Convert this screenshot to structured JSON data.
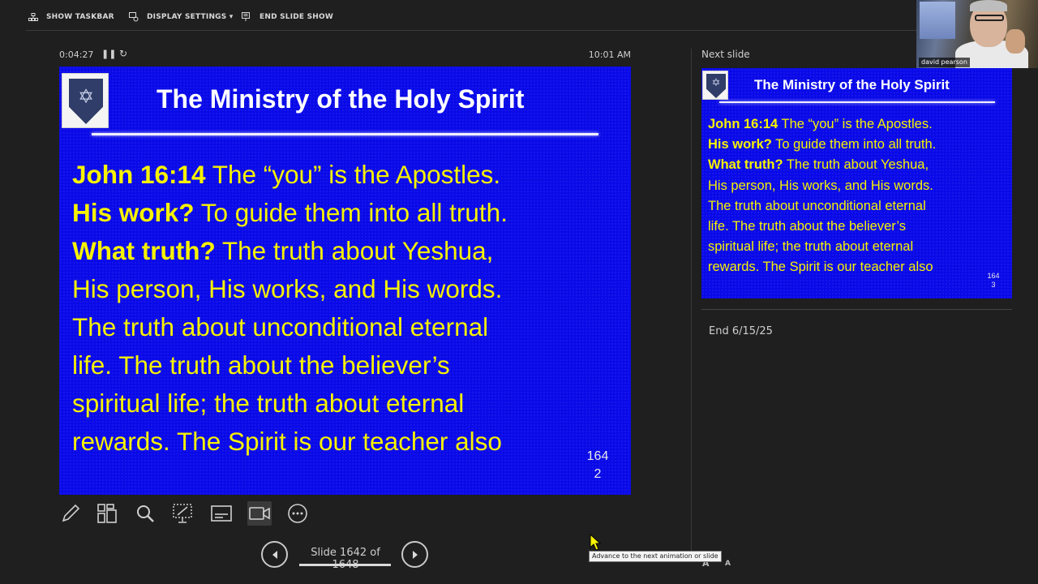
{
  "toolbar": {
    "show_taskbar": "SHOW TASKBAR",
    "display_settings": "DISPLAY SETTINGS ▾",
    "end_slide_show": "END SLIDE SHOW"
  },
  "webcam": {
    "name": "david pearson"
  },
  "presenter": {
    "elapsed": "0:04:27",
    "clock": "10:01 AM",
    "pause_icon": "pause-icon",
    "restart_icon": "restart-icon"
  },
  "current_slide": {
    "title": "The Ministry of the Holy Spirit",
    "lines": [
      {
        "bold": "John 16:14",
        "text": " The “you” is the Apostles."
      },
      {
        "bold": "His work?",
        "text": " To guide them into all truth."
      },
      {
        "bold": "What truth?",
        "text": " The truth about Yeshua,"
      },
      {
        "bold": "",
        "text": "His person, His works, and His words."
      },
      {
        "bold": "",
        "text": "The truth about unconditional eternal"
      },
      {
        "bold": "",
        "text": "life. The truth about the believer’s"
      },
      {
        "bold": "",
        "text": "spiritual life; the truth about eternal"
      },
      {
        "bold": "",
        "text": "rewards. The Spirit is our teacher also"
      }
    ],
    "number_top": "164",
    "number_bottom": "2"
  },
  "tools": [
    "pen-icon",
    "all-slides-icon",
    "zoom-icon",
    "laser-pointer-icon",
    "subtitles-icon",
    "camera-icon",
    "more-options-icon"
  ],
  "navigation": {
    "label": "Slide 1642 of 1648",
    "tooltip": "Advance to the next animation or slide"
  },
  "next_panel": {
    "label": "Next slide",
    "slide": {
      "title": "The Ministry of the Holy Spirit",
      "lines": [
        {
          "bold": "John 16:14",
          "text": " The “you” is the Apostles."
        },
        {
          "bold": "His work?",
          "text": " To guide them into all truth."
        },
        {
          "bold": "What truth?",
          "text": " The truth about Yeshua,"
        },
        {
          "bold": "",
          "text": "His person, His works, and His words."
        },
        {
          "bold": "",
          "text": "The truth about unconditional eternal"
        },
        {
          "bold": "",
          "text": "life. The truth about the believer’s"
        },
        {
          "bold": "",
          "text": "spiritual life; the truth about eternal"
        },
        {
          "bold": "",
          "text": "rewards. The Spirit is our teacher also"
        }
      ],
      "number_top": "164",
      "number_bottom": "3"
    },
    "notes": "End 6/15/25",
    "font_increase": "A",
    "font_decrease": "A"
  },
  "colors": {
    "background": "#1f1f1f",
    "slide_background": "#0a0ae8",
    "slide_body_text": "#f7f200",
    "slide_title_text": "#ffffff"
  }
}
